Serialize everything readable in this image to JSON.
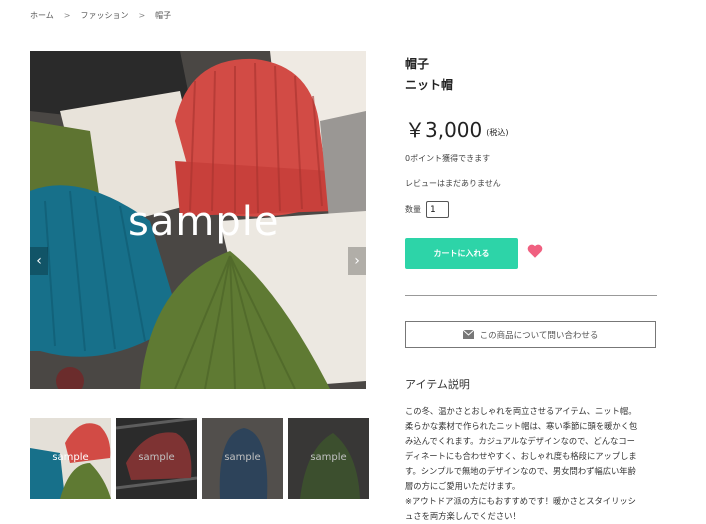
{
  "breadcrumb": {
    "home": "ホーム",
    "separator": ">",
    "category": "ファッション",
    "current": "帽子"
  },
  "gallery": {
    "main_watermark": "sample",
    "prev_icon": "chevron-left-icon",
    "next_icon": "chevron-right-icon",
    "thumbnails": [
      {
        "label": "sample",
        "color": "#b33b3b"
      },
      {
        "label": "sample",
        "color": "#a84545"
      },
      {
        "label": "sample",
        "color": "#3c5a78"
      },
      {
        "label": "sample",
        "color": "#506a3e"
      }
    ]
  },
  "product": {
    "category": "帽子",
    "name": "ニット帽",
    "price": "￥3,000",
    "tax_note": "(税込)",
    "points": "0ポイント獲得できます",
    "review": "レビューはまだありません",
    "quantity_label": "数量",
    "quantity_value": "1",
    "cart_button": "カートに入れる",
    "favorite_icon": "heart-icon",
    "accent_color": "#2dd4a8",
    "heart_color": "#f06080"
  },
  "inquiry": {
    "label": "この商品について問い合わせる",
    "icon": "envelope-icon"
  },
  "description": {
    "title": "アイテム説明",
    "lines": [
      "この冬、温かさとおしゃれを両立させるアイテム、ニット帽。",
      "柔らかな素材で作られたニット帽は、寒い季節に頭を暖かく包",
      "み込んでくれます。カジュアルなデザインなので、どんなコー",
      "ディネートにも合わせやすく、おしゃれ度も格段にアップしま",
      "す。シンプルで無地のデザインなので、男女問わず幅広い年齢",
      "層の方にご愛用いただけます。",
      "※アウトドア派の方にもおすすめです！暖かさとスタイリッシ",
      "ュさを両方楽しんでください！"
    ]
  }
}
